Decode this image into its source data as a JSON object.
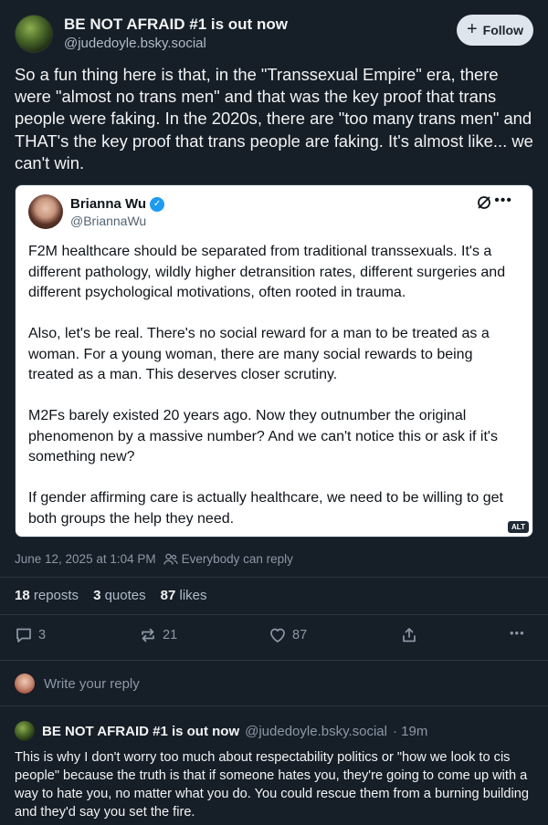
{
  "post": {
    "author_name": "BE NOT AFRAID #1 is out now",
    "author_handle": "@judedoyle.bsky.social",
    "follow_label": "Follow",
    "text": "So a fun thing here is that, in the \"Transsexual Empire\" era, there were \"almost no trans men\" and that was the key proof that trans people were faking. In the 2020s, there are \"too many trans men\" and THAT's the key proof that trans people are faking. It's almost like... we can't win.",
    "timestamp": "June 12, 2025 at 1:04 PM",
    "reply_setting": "Everybody can reply"
  },
  "quote": {
    "name": "Brianna Wu",
    "handle": "@BriannaWu",
    "paragraphs": [
      "F2M healthcare should be separated from traditional transsexuals. It's a different pathology, wildly higher detransition rates, different surgeries and different psychological motivations, often rooted in trauma.",
      "Also, let's be real. There's no social reward for a man to be treated as a woman. For a young woman, there are many social rewards to being treated as a man. This deserves closer scrutiny.",
      "M2Fs barely existed 20 years ago. Now they outnumber the original phenomenon by a massive number? And we can't notice this or ask if it's something new?",
      "If gender affirming care is actually healthcare, we need to be willing to get both groups the help they need."
    ],
    "alt_badge": "ALT"
  },
  "stats": {
    "reposts_count": "18",
    "reposts_label": "reposts",
    "quotes_count": "3",
    "quotes_label": "quotes",
    "likes_count": "87",
    "likes_label": "likes"
  },
  "actions": {
    "reply_count": "3",
    "repost_count": "21",
    "like_count": "87"
  },
  "composer": {
    "placeholder": "Write your reply"
  },
  "reply": {
    "author_name": "BE NOT AFRAID #1 is out now",
    "author_handle": "@judedoyle.bsky.social",
    "time": "· 19m",
    "text": "This is why I don't worry too much about respectability politics or \"how we look to cis people\" because the truth is that if someone hates you, they're going to come up with a way to hate you, no matter what you do. You could rescue them from a burning building and they'd say you set the fire."
  },
  "colors": {
    "background": "#161e27",
    "text_primary": "#f1f3f5",
    "text_secondary": "#8b98a7",
    "follow_button_bg": "#dfe5ec",
    "verified_blue": "#1d9bf0"
  },
  "icons": [
    "plus-icon",
    "verified-icon",
    "grok-icon",
    "more-icon",
    "people-icon",
    "reply-icon",
    "repost-icon",
    "like-icon",
    "share-icon"
  ]
}
